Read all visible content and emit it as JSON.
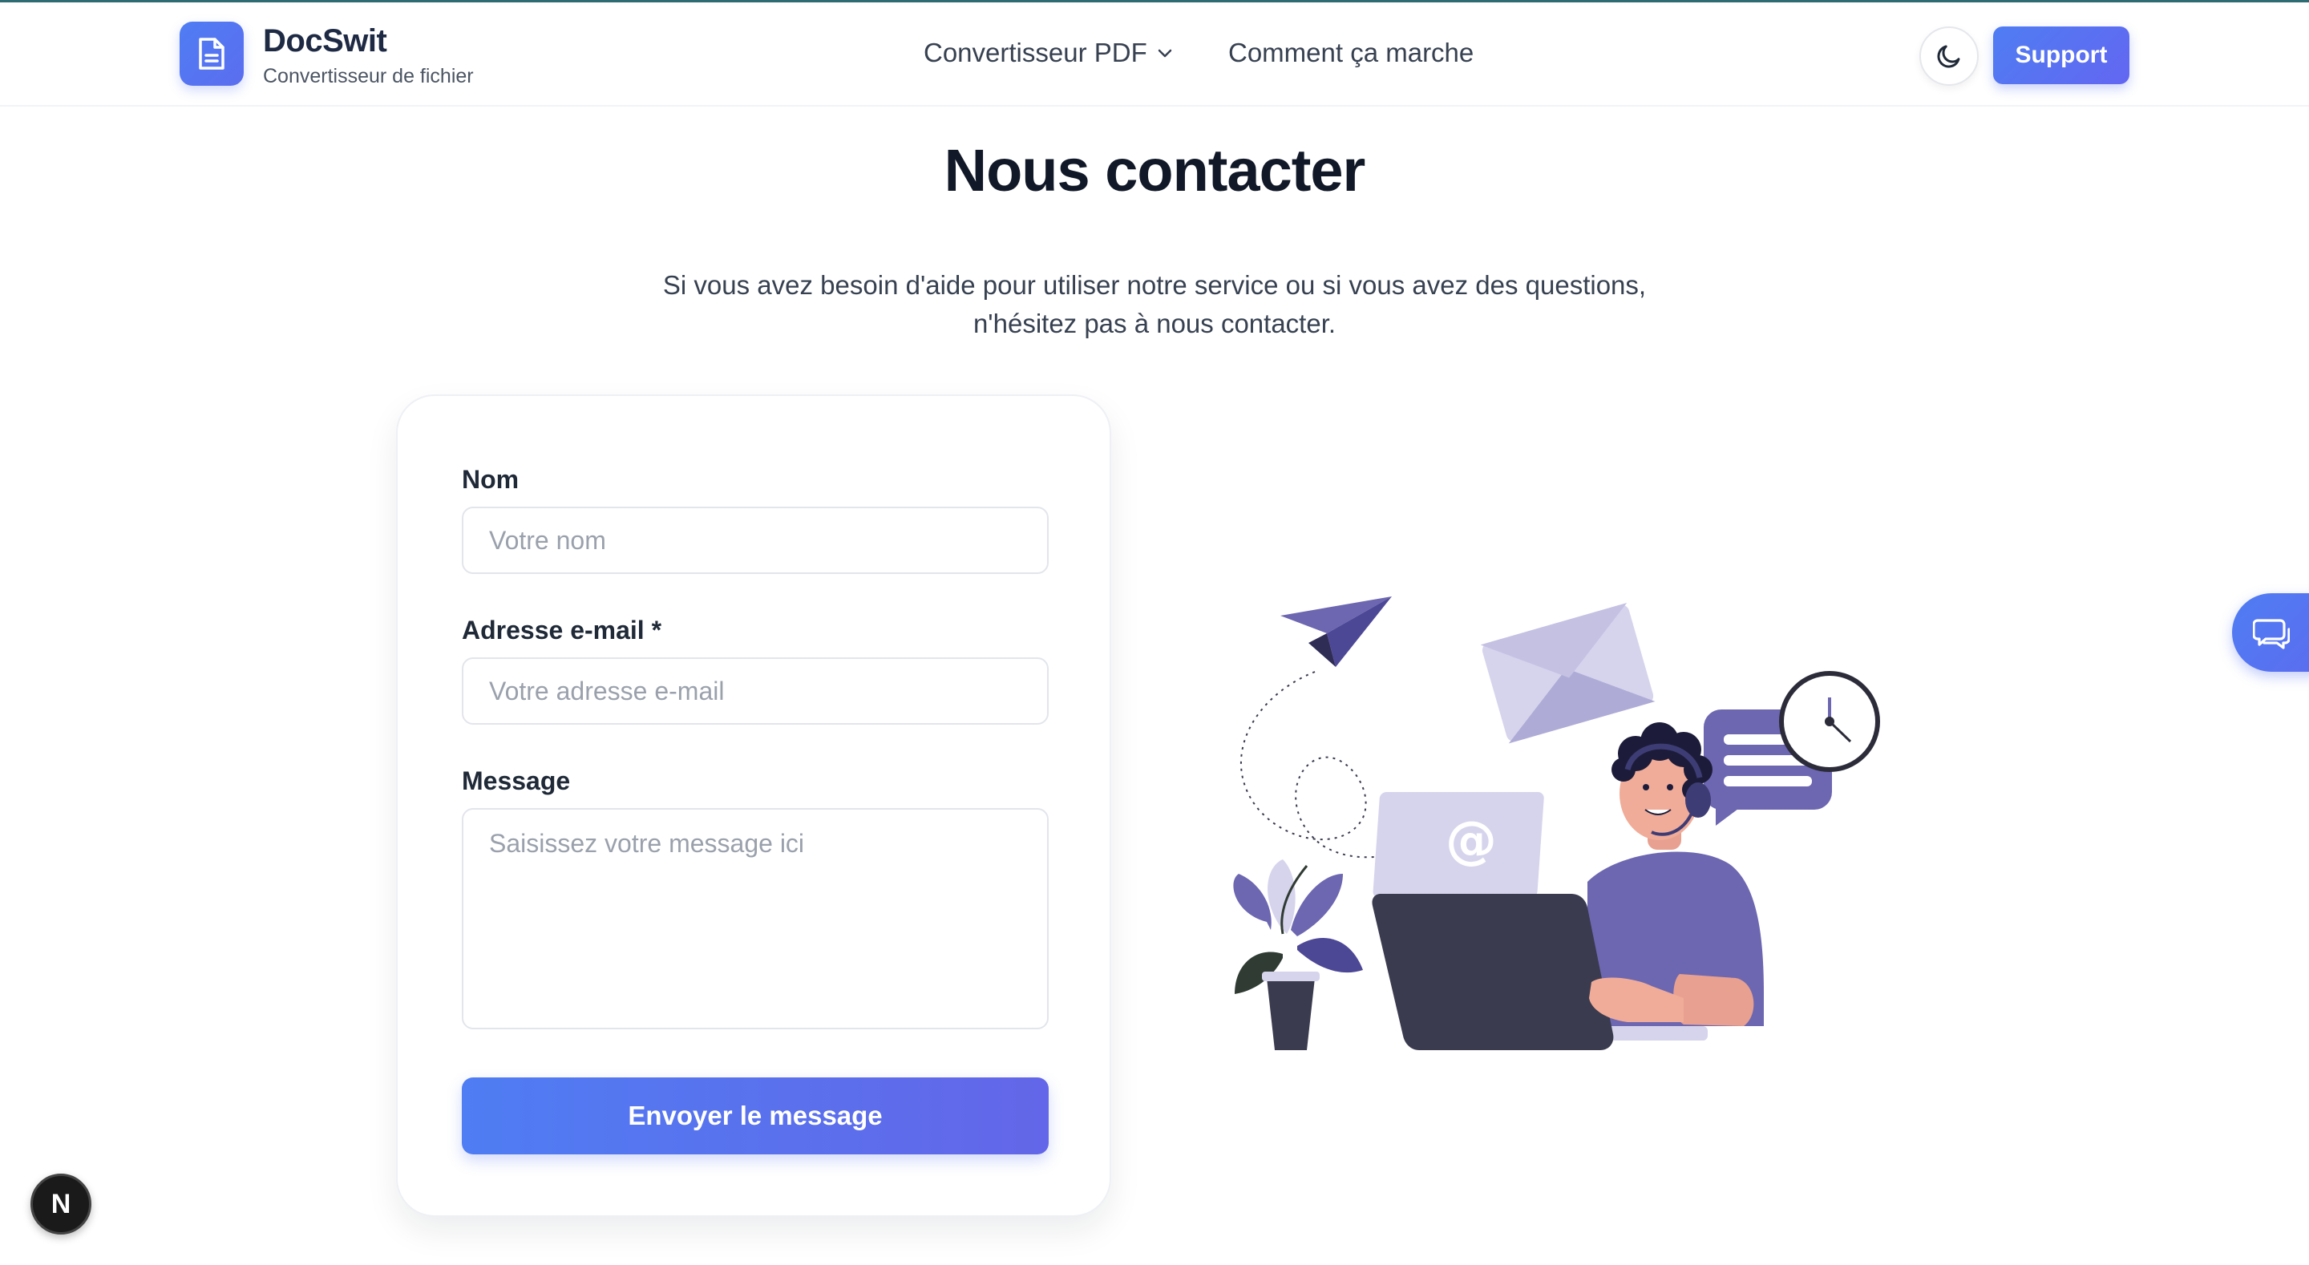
{
  "colors": {
    "accent": "#4f7df3",
    "accent_end": "#6366f1",
    "illustration_purple": "#6c67b0",
    "dark": "#3a3b4f"
  },
  "header": {
    "brand_name": "DocSwit",
    "brand_sub": "Convertisseur de fichier",
    "nav": [
      {
        "label": "Convertisseur PDF",
        "has_dropdown": true
      },
      {
        "label": "Comment ça marche",
        "has_dropdown": false
      }
    ],
    "theme_icon": "moon-icon",
    "support_label": "Support"
  },
  "main": {
    "title": "Nous contacter",
    "intro_line1": "Si vous avez besoin d'aide pour utiliser notre service ou si vous avez des questions,",
    "intro_line2": "n'hésitez pas à nous contacter."
  },
  "form": {
    "name_label": "Nom",
    "name_placeholder": "Votre nom",
    "email_label": "Adresse e-mail *",
    "email_placeholder": "Votre adresse e-mail",
    "message_label": "Message",
    "message_placeholder": "Saisissez votre message ici",
    "submit_label": "Envoyer le message"
  },
  "illustration": {
    "at_symbol": "@"
  },
  "floating": {
    "chat_icon": "chat-bubbles-icon",
    "badge_letter": "N"
  }
}
